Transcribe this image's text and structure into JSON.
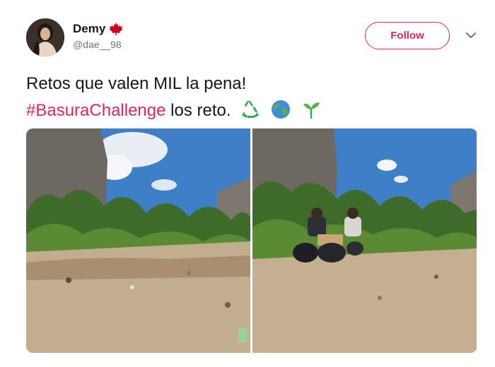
{
  "tweet": {
    "author": {
      "display_name": "Demy",
      "handle": "@dae__98",
      "flag_icon": "maple-leaf-icon",
      "avatar_icon": "avatar"
    },
    "follow_label": "Follow",
    "menu_icon": "chevron-down-icon",
    "text_line1": "Retos que valen MIL la pena!",
    "hashtag": "#BasuraChallenge",
    "text_line2_rest": " los reto.",
    "emojis": [
      "recycle-icon",
      "globe-icon",
      "seedling-icon"
    ],
    "media": [
      {
        "name": "before-photo"
      },
      {
        "name": "after-photo"
      }
    ],
    "colors": {
      "accent": "#e0245e",
      "text": "#14171a",
      "secondary_text": "#657786"
    }
  }
}
